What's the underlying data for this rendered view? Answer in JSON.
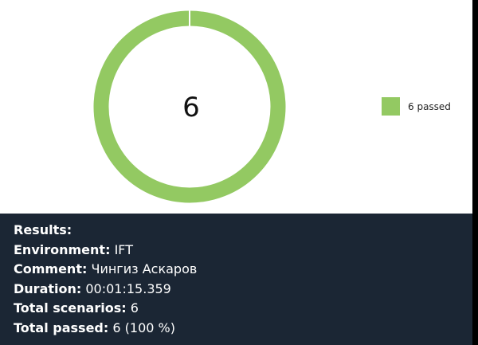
{
  "chart": {
    "center_count": "6",
    "colors": {
      "passed": "#93c962",
      "separator": "#ffffff"
    }
  },
  "chart_data": {
    "type": "pie",
    "categories": [
      "passed"
    ],
    "values": [
      6
    ],
    "legend": [
      "6 passed"
    ],
    "legend_position": "right"
  },
  "legend": {
    "items": [
      {
        "label": "6 passed",
        "color": "#93c962"
      }
    ]
  },
  "results": {
    "heading": "Results:",
    "environment_label": "Environment:",
    "environment_value": "IFT",
    "comment_label": "Comment:",
    "comment_value": "Чингиз Аскаров",
    "duration_label": "Duration:",
    "duration_value": "00:01:15.359",
    "total_scenarios_label": "Total scenarios:",
    "total_scenarios_value": "6",
    "total_passed_label": "Total passed:",
    "total_passed_value": "6 (100 %)"
  },
  "colors": {
    "panel_background": "#1b2634",
    "panel_text": "#ffffff"
  }
}
